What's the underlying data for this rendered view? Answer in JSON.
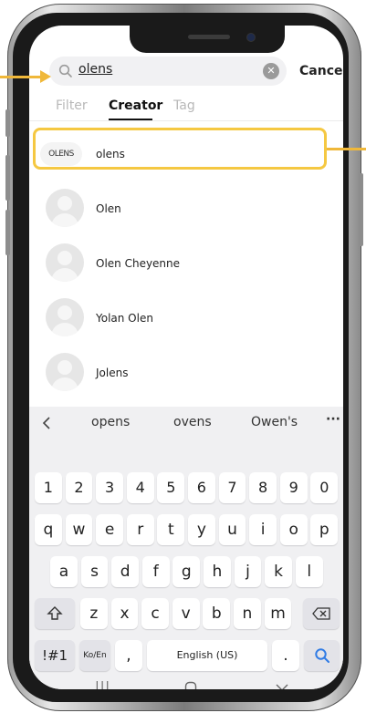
{
  "search": {
    "query": "olens",
    "cancel_label": "Cancel"
  },
  "tabs": [
    {
      "label": "Filter"
    },
    {
      "label": "Creator"
    },
    {
      "label": "Tag"
    }
  ],
  "results": [
    {
      "name": "olens",
      "logo_text": "OLENS"
    },
    {
      "name": "Olen"
    },
    {
      "name": "Olen Cheyenne"
    },
    {
      "name": "Yolan Olen"
    },
    {
      "name": "Jolens"
    }
  ],
  "keyboard": {
    "suggestions": [
      "opens",
      "ovens",
      "Owen's"
    ],
    "number_row": [
      "1",
      "2",
      "3",
      "4",
      "5",
      "6",
      "7",
      "8",
      "9",
      "0"
    ],
    "row1": [
      "q",
      "w",
      "e",
      "r",
      "t",
      "y",
      "u",
      "i",
      "o",
      "p"
    ],
    "row2": [
      "a",
      "s",
      "d",
      "f",
      "g",
      "h",
      "j",
      "k",
      "l"
    ],
    "row3": [
      "z",
      "x",
      "c",
      "v",
      "b",
      "n",
      "m"
    ],
    "symbols_label": "!#1",
    "lang_switch_label": "Ko/En",
    "comma_label": ",",
    "space_label": "English (US)",
    "period_label": "."
  },
  "colors": {
    "highlight": "#f5c842",
    "search_key": "#2f7be5"
  }
}
